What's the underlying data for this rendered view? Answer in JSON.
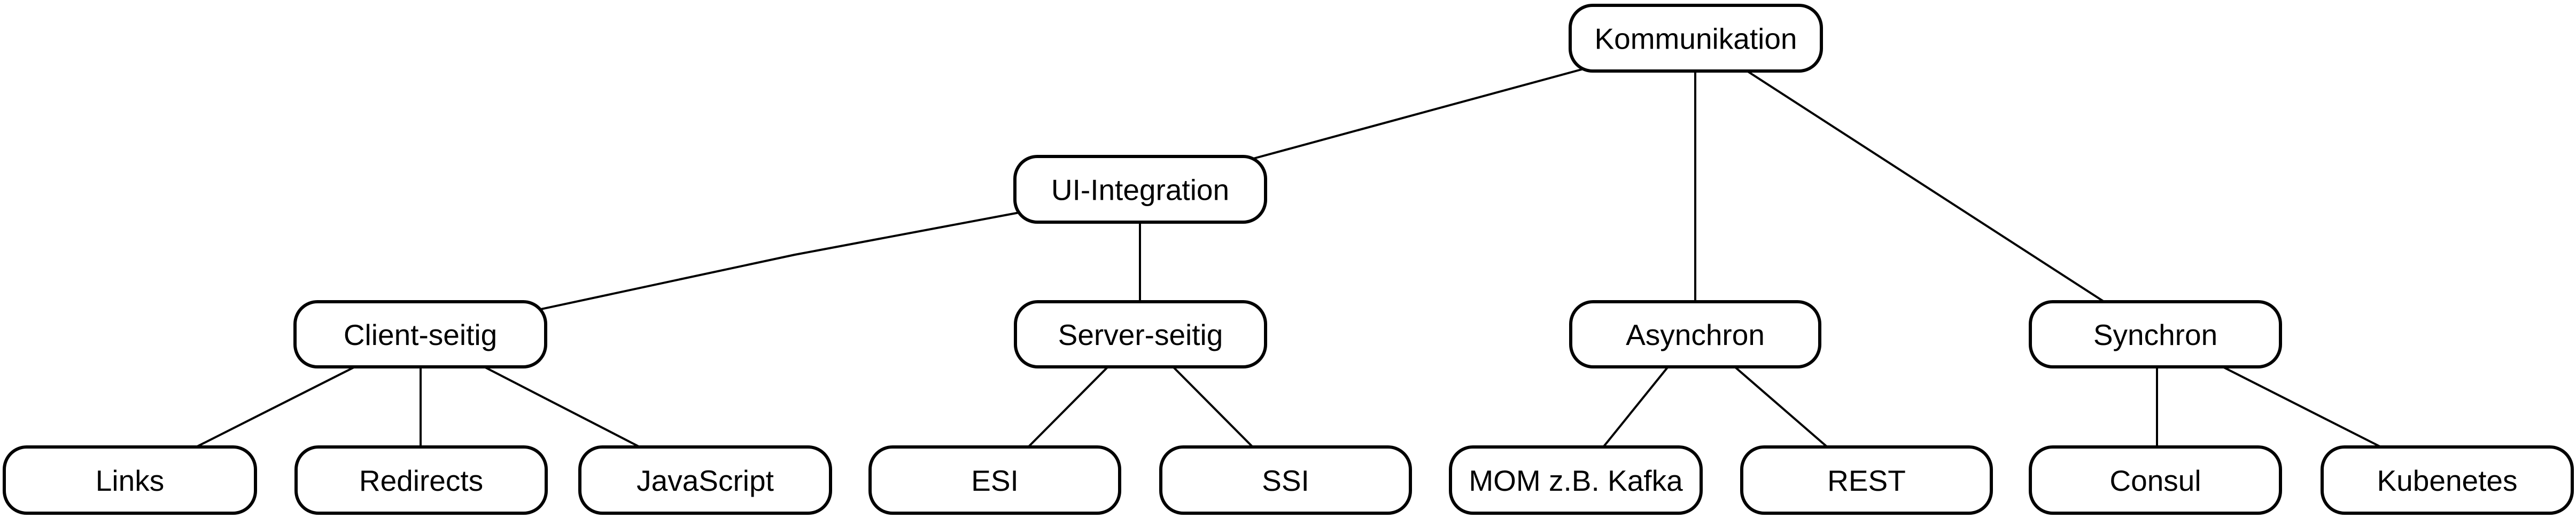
{
  "diagram": {
    "type": "tree",
    "colors": {
      "stroke": "#000000",
      "fill": "#ffffff",
      "text": "#000000"
    },
    "nodes": [
      {
        "id": "kommunikation",
        "label": "Kommunikation",
        "parent": null
      },
      {
        "id": "ui-integration",
        "label": "UI-Integration",
        "parent": "kommunikation"
      },
      {
        "id": "client-seitig",
        "label": "Client-seitig",
        "parent": "ui-integration"
      },
      {
        "id": "server-seitig",
        "label": "Server-seitig",
        "parent": "ui-integration"
      },
      {
        "id": "asynchron",
        "label": "Asynchron",
        "parent": "kommunikation"
      },
      {
        "id": "synchron",
        "label": "Synchron",
        "parent": "kommunikation"
      },
      {
        "id": "links",
        "label": "Links",
        "parent": "client-seitig"
      },
      {
        "id": "redirects",
        "label": "Redirects",
        "parent": "client-seitig"
      },
      {
        "id": "javascript",
        "label": "JavaScript",
        "parent": "client-seitig"
      },
      {
        "id": "esi",
        "label": "ESI",
        "parent": "server-seitig"
      },
      {
        "id": "ssi",
        "label": "SSI",
        "parent": "server-seitig"
      },
      {
        "id": "mom-kafka",
        "label": "MOM z.B. Kafka",
        "parent": "asynchron"
      },
      {
        "id": "rest",
        "label": "REST",
        "parent": "asynchron"
      },
      {
        "id": "consul",
        "label": "Consul",
        "parent": "synchron"
      },
      {
        "id": "kubenetes",
        "label": "Kubenetes",
        "parent": "synchron"
      }
    ]
  }
}
